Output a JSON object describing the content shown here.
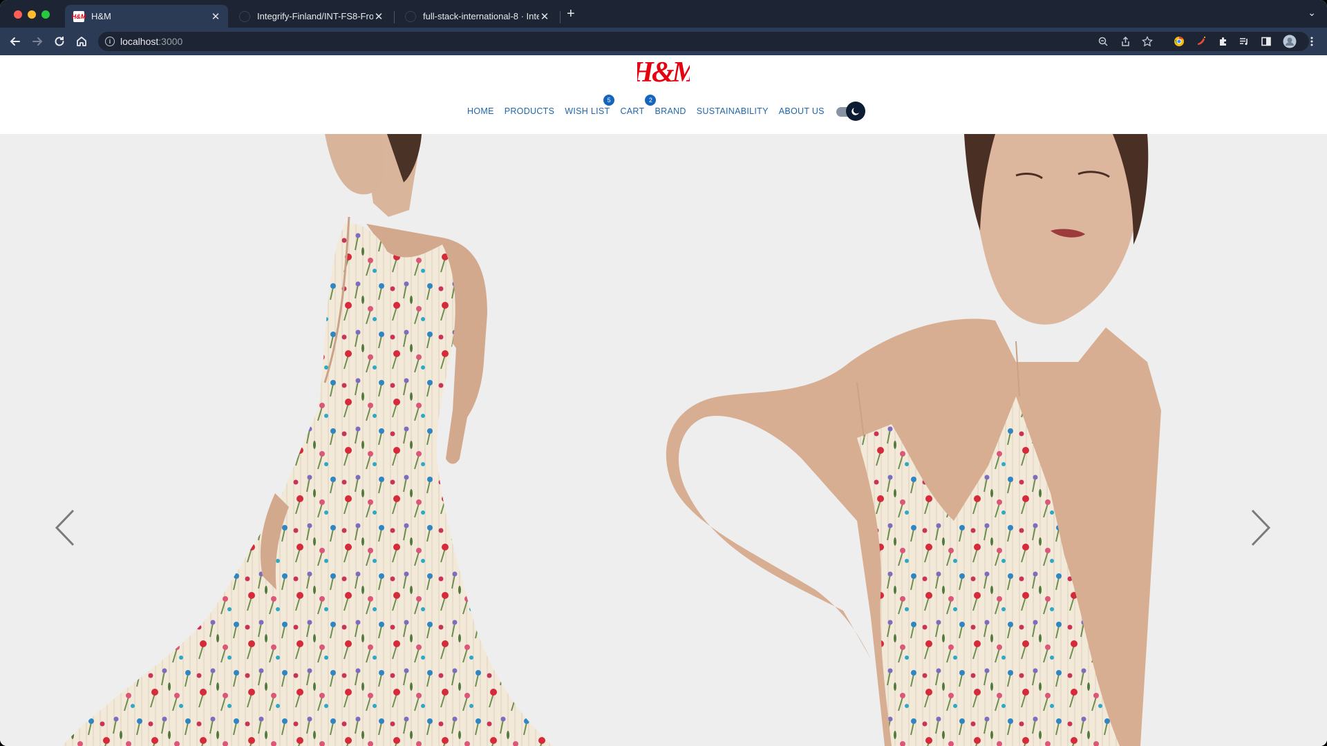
{
  "browser": {
    "tabs": [
      {
        "title": "H&M",
        "favicon": "hm-logo-icon",
        "active": true
      },
      {
        "title": "Integrify-Finland/INT-FS8-Fron",
        "favicon": "github-icon",
        "active": false
      },
      {
        "title": "full-stack-international-8 · Inte",
        "favicon": "github-icon",
        "active": false
      }
    ],
    "address": {
      "host": "localhost",
      "port": ":3000"
    }
  },
  "site": {
    "logo_text": "H&M",
    "nav": {
      "home": "HOME",
      "products": "PRODUCTS",
      "wishlist": "WISH LIST",
      "wishlist_count": "5",
      "cart": "CART",
      "cart_count": "2",
      "brand": "BRAND",
      "sustainability": "SUSTAINABILITY",
      "about": "ABOUT US"
    },
    "theme_toggle": {
      "mode": "dark",
      "icon": "moon-icon"
    },
    "colors": {
      "nav_link": "#1f66a8",
      "badge": "#1565c0",
      "logo": "#e50010"
    }
  },
  "carousel": {
    "prev_icon": "chevron-left-icon",
    "next_icon": "chevron-right-icon"
  }
}
